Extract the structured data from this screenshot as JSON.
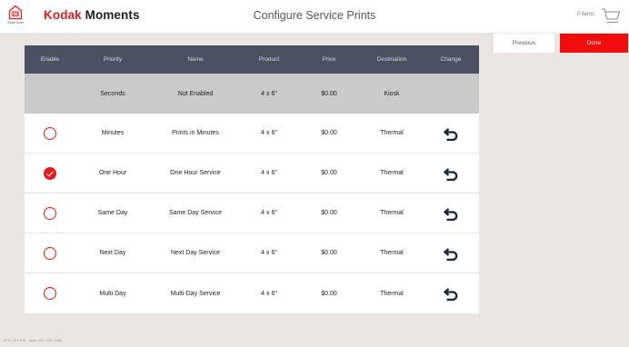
{
  "header": {
    "home_label": "Start Over",
    "brand_part1": "Kodak",
    "brand_part2": "Moments",
    "page_title": "Configure Service Prints",
    "cart_count": "0 items"
  },
  "actions": {
    "previous_label": "Previous",
    "done_label": "Done"
  },
  "table": {
    "columns": [
      "Enable",
      "Priority",
      "Name",
      "Product",
      "Price",
      "Destination",
      "Change"
    ],
    "rows": [
      {
        "enabled": null,
        "priority": "Seconds",
        "name": "Not Enabled",
        "product": "4 x 6\"",
        "price": "$0.00",
        "destination": "Kiosk"
      },
      {
        "enabled": false,
        "priority": "Minutes",
        "name": "Prints in Minutes",
        "product": "4 x 6\"",
        "price": "$0.00",
        "destination": "Thermal"
      },
      {
        "enabled": true,
        "priority": "One Hour",
        "name": "One Hour Service",
        "product": "4 x 6\"",
        "price": "$0.00",
        "destination": "Thermal"
      },
      {
        "enabled": false,
        "priority": "Same Day",
        "name": "Same Day Service",
        "product": "4 x 6\"",
        "price": "$0.00",
        "destination": "Thermal"
      },
      {
        "enabled": false,
        "priority": "Next Day",
        "name": "Next Day Service",
        "product": "4 x 6\"",
        "price": "$0.00",
        "destination": "Thermal"
      },
      {
        "enabled": false,
        "priority": "Multi Day",
        "name": "Multi-Day Service",
        "product": "4 x 6\"",
        "price": "$0.00",
        "destination": "Thermal"
      }
    ]
  },
  "footer": {
    "build_info": "KPH: V6.0.P.W... Build: 2017.2007.0050"
  },
  "colors": {
    "accent": "#e31b1b",
    "header_bg": "#4a5160",
    "disabled_row": "#cacaca",
    "page_bg": "#e9e6e3"
  },
  "icons": {
    "home": "home-icon",
    "cart": "cart-icon",
    "change": "undo-arrow-icon",
    "check": "check-icon"
  }
}
